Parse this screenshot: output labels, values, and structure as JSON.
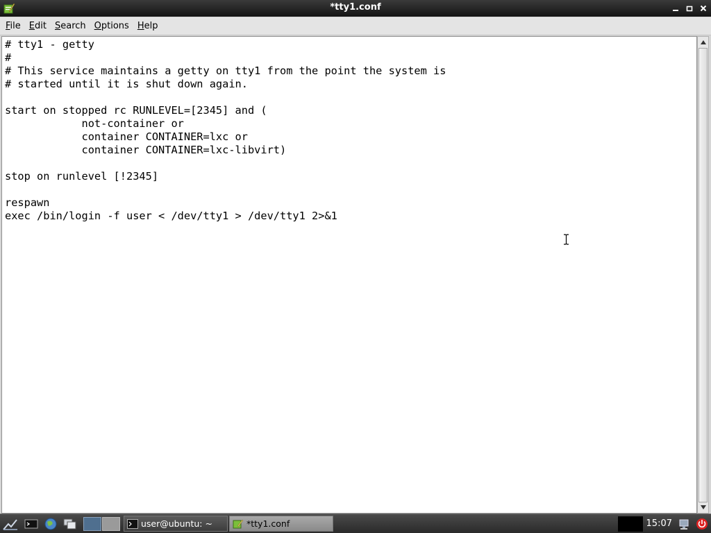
{
  "window": {
    "title": "*tty1.conf",
    "buttons": {
      "minimize": "–",
      "maximize": "□",
      "close": "✕"
    }
  },
  "menu": {
    "items": [
      {
        "mnemonic": "F",
        "rest": "ile"
      },
      {
        "mnemonic": "E",
        "rest": "dit"
      },
      {
        "mnemonic": "S",
        "rest": "earch"
      },
      {
        "mnemonic": "O",
        "rest": "ptions"
      },
      {
        "mnemonic": "H",
        "rest": "elp"
      }
    ]
  },
  "editor": {
    "content": "# tty1 - getty\n#\n# This service maintains a getty on tty1 from the point the system is\n# started until it is shut down again.\n\nstart on stopped rc RUNLEVEL=[2345] and (\n            not-container or\n            container CONTAINER=lxc or\n            container CONTAINER=lxc-libvirt)\n\nstop on runlevel [!2345]\n\nrespawn\nexec /bin/login -f user < /dev/tty1 > /dev/tty1 2>&1"
  },
  "taskbar": {
    "tasks": [
      {
        "label": "user@ubuntu: ~",
        "icon": "terminal-icon",
        "active": false
      },
      {
        "label": "*tty1.conf",
        "icon": "text-editor-icon",
        "active": true
      }
    ],
    "clock": "15:07"
  },
  "colors": {
    "titlebar": "#1e1e1e",
    "editor_bg": "#ffffff",
    "menubar_bg": "#e4e4e4",
    "taskbar_bg": "#3a3a3a"
  }
}
